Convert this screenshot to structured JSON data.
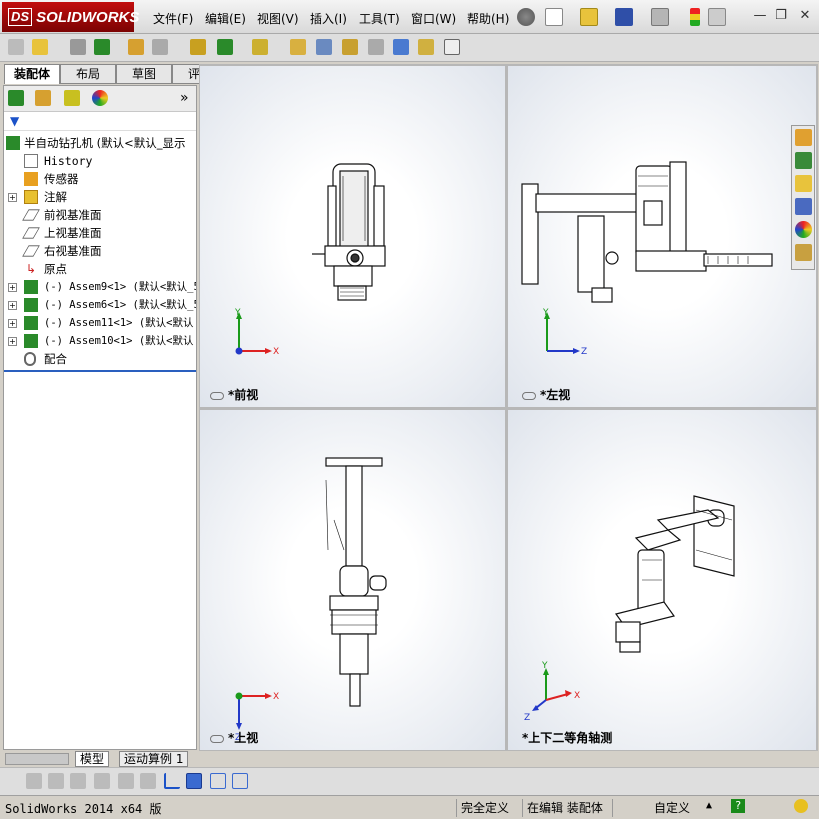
{
  "app": {
    "brand": "SOLIDWORKS",
    "brand_prefix": "DS"
  },
  "menu": [
    {
      "label": "文件(F)"
    },
    {
      "label": "编辑(E)"
    },
    {
      "label": "视图(V)"
    },
    {
      "label": "插入(I)"
    },
    {
      "label": "工具(T)"
    },
    {
      "label": "窗口(W)"
    },
    {
      "label": "帮助(H)"
    }
  ],
  "window_controls": {
    "minimize": "—",
    "restore": "❐",
    "close": "✕"
  },
  "left_tabs": [
    "装配体",
    "布局",
    "草图",
    "评估"
  ],
  "panel_expand": "»",
  "tree": {
    "root": "半自动钻孔机  (默认<默认_显示",
    "items": [
      {
        "label": "History",
        "mono": true
      },
      {
        "label": "传感器"
      },
      {
        "label": "注解"
      },
      {
        "label": "前视基准面"
      },
      {
        "label": "上视基准面"
      },
      {
        "label": "右视基准面"
      },
      {
        "label": "原点"
      },
      {
        "label": "(-) Assem9<1> (默认<默认_5",
        "mono": true
      },
      {
        "label": "(-) Assem6<1> (默认<默认_5",
        "mono": true
      },
      {
        "label": "(-) Assem11<1> (默认<默认",
        "mono": true
      },
      {
        "label": "(-) Assem10<1> (默认<默认",
        "mono": true
      },
      {
        "label": "配合"
      }
    ]
  },
  "views": {
    "front": "*前视",
    "left": "*左视",
    "top": "*上视",
    "iso": "*上下二等角轴测"
  },
  "axes": {
    "x": "X",
    "y": "Y",
    "z": "Z"
  },
  "bottom_tabs": [
    "模型",
    "运动算例 1"
  ],
  "status": {
    "app": "SolidWorks 2014 x64 版",
    "state": "完全定义",
    "editing": "在编辑 装配体",
    "units": "自定义",
    "help": "?"
  },
  "colors": {
    "brand_red": "#b30c0c",
    "axis_x": "#d22",
    "axis_y": "#1a9a1a",
    "axis_z": "#2238c8"
  }
}
